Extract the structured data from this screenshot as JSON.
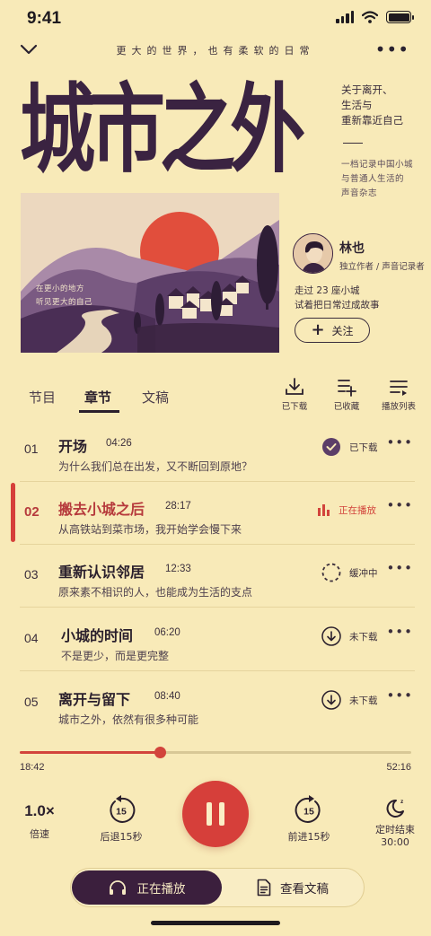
{
  "status_bar": {
    "time": "9:41"
  },
  "header": {
    "tagline": "更大的世界，也有柔软的日常",
    "title": "城市之外",
    "side_note": [
      "关于离开、",
      "生活与",
      "重新靠近自己"
    ],
    "side_desc": [
      "一档记录中国小城",
      "与普通人生活的",
      "声音杂志"
    ]
  },
  "cover": {
    "caption": [
      "在更小的地方",
      "听见更大的自己"
    ]
  },
  "author": {
    "name": "林也",
    "role": "独立作者 / 声音记录者",
    "desc": [
      "走过 23 座小城",
      "试着把日常过成故事"
    ],
    "follow_label": "关注"
  },
  "tabs": [
    {
      "label": "节目",
      "active": false
    },
    {
      "label": "章节",
      "active": true
    },
    {
      "label": "文稿",
      "active": false
    }
  ],
  "tools": {
    "downloaded": "已下载",
    "saved": "已收藏",
    "playlist": "播放列表"
  },
  "chapters": [
    {
      "num": "01",
      "title": "开场",
      "duration": "04:26",
      "subtitle": "为什么我们总在出发，又不断回到原地？",
      "status": "已下载"
    },
    {
      "num": "02",
      "title": "搬去小城之后",
      "duration": "28:17",
      "subtitle": "从高铁站到菜市场，我开始学会慢下来",
      "status": "正在播放"
    },
    {
      "num": "03",
      "title": "重新认识邻居",
      "duration": "12:33",
      "subtitle": "原来素不相识的人，也能成为生活的支点",
      "status": "缓冲中"
    },
    {
      "num": "04",
      "title": "小城的时间",
      "duration": "06:20",
      "subtitle": "不是更少，而是更完整",
      "status": "未下载"
    },
    {
      "num": "05",
      "title": "离开与留下",
      "duration": "08:40",
      "subtitle": "城市之外，依然有很多种可能",
      "status": "未下载"
    }
  ],
  "player": {
    "elapsed": "18:42",
    "total": "52:16",
    "progress": 0.358,
    "speed_value": "1.0×",
    "speed_label": "倍速",
    "rewind_seconds": "15",
    "rewind_label": "后退15秒",
    "forward_seconds": "15",
    "forward_label": "前进15秒",
    "timer_label": "定时结束",
    "timer_value": "30:00"
  },
  "bottom_bar": {
    "now_playing": "正在播放",
    "transcript": "查看文稿"
  },
  "colors": {
    "background": "#f8eab8",
    "accent": "#d63f3a",
    "ink": "#3a2341"
  }
}
